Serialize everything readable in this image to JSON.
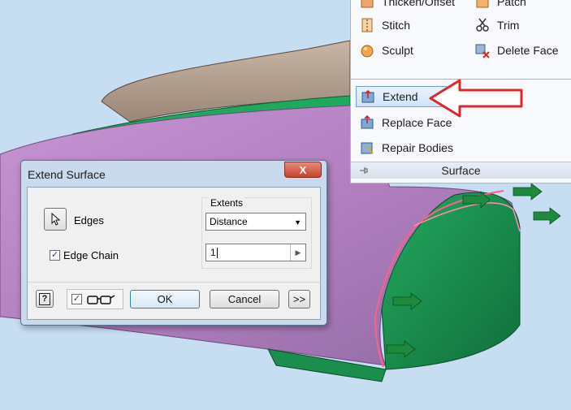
{
  "ribbon": {
    "top_left_label": "Thicken/Offset",
    "top_right_label": "Patch",
    "stitch_label": "Stitch",
    "trim_label": "Trim",
    "sculpt_label": "Sculpt",
    "delete_face_label": "Delete Face",
    "extend_label": "Extend",
    "replace_face_label": "Replace Face",
    "repair_bodies_label": "Repair Bodies",
    "panel_title": "Surface"
  },
  "dialog": {
    "title": "Extend Surface",
    "close_label": "X",
    "edges_label": "Edges",
    "edge_chain_label": "Edge Chain",
    "edge_chain_checked": true,
    "extents_label": "Extents",
    "extents_value": "Distance",
    "distance_value": "1",
    "ok_label": "OK",
    "cancel_label": "Cancel",
    "more_label": ">>",
    "help_label": "?",
    "preview_checked": true
  },
  "colors": {
    "viewport_bg": "#c7ddf1",
    "surface_purple": "#b784c2",
    "surface_green": "#1e9a55",
    "annotation_red": "#e0262a",
    "highlight_blue": "#6fa4d9"
  }
}
